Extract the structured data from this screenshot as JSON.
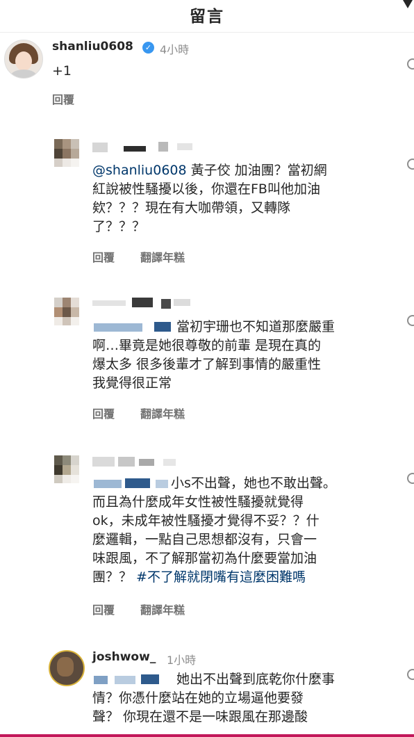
{
  "header": {
    "title": "留言"
  },
  "main_comment": {
    "username": "shanliu0608",
    "time": "4小時",
    "text": "+1",
    "reply_label": "回覆"
  },
  "replies": [
    {
      "mention": "@shanliu0608",
      "text": [
        " 黃子佼 加油團？當初網",
        "紅說被性騷擾以後，你還在FB叫他加油",
        "欸？？？現在有大咖帶領，又轉隊",
        "了？？？"
      ],
      "reply_label": "回覆",
      "translate_label": "翻譯年糕"
    },
    {
      "text": [
        "當初宇珊也不知道那麼嚴重",
        "啊…畢竟是她很尊敬的前輩 是現在真的",
        "爆太多 很多後輩才了解到事情的嚴重性",
        "我覺得很正常"
      ],
      "reply_label": "回覆",
      "translate_label": "翻譯年糕"
    },
    {
      "text": [
        "小s不出聲，她也不敢出聲。",
        "而且為什麼成年女性被性騷擾就覺得",
        "ok，未成年被性騷擾才覺得不妥？？什",
        "麼邏輯，一點自己思想都沒有，只會一",
        "味跟風，不了解那當初為什麼要當加油"
      ],
      "last_line": "團？？ ",
      "hashtag": "#不了解就閉嘴有這麼困難嗎",
      "reply_label": "回覆",
      "translate_label": "翻譯年糕"
    },
    {
      "username": "joshwow_",
      "time": "1小時",
      "text": [
        "她出不出聲到底乾你什麼事",
        "情？你憑什麼站在她的立場逼他要發",
        "聲？ 你現在還不是一味跟風在那邊酸"
      ]
    }
  ],
  "colors": {
    "link": "#00376b",
    "verified": "#3897f0",
    "muted": "#8e8e8e"
  },
  "icons": [
    "verified-badge-icon",
    "heart-icon"
  ]
}
